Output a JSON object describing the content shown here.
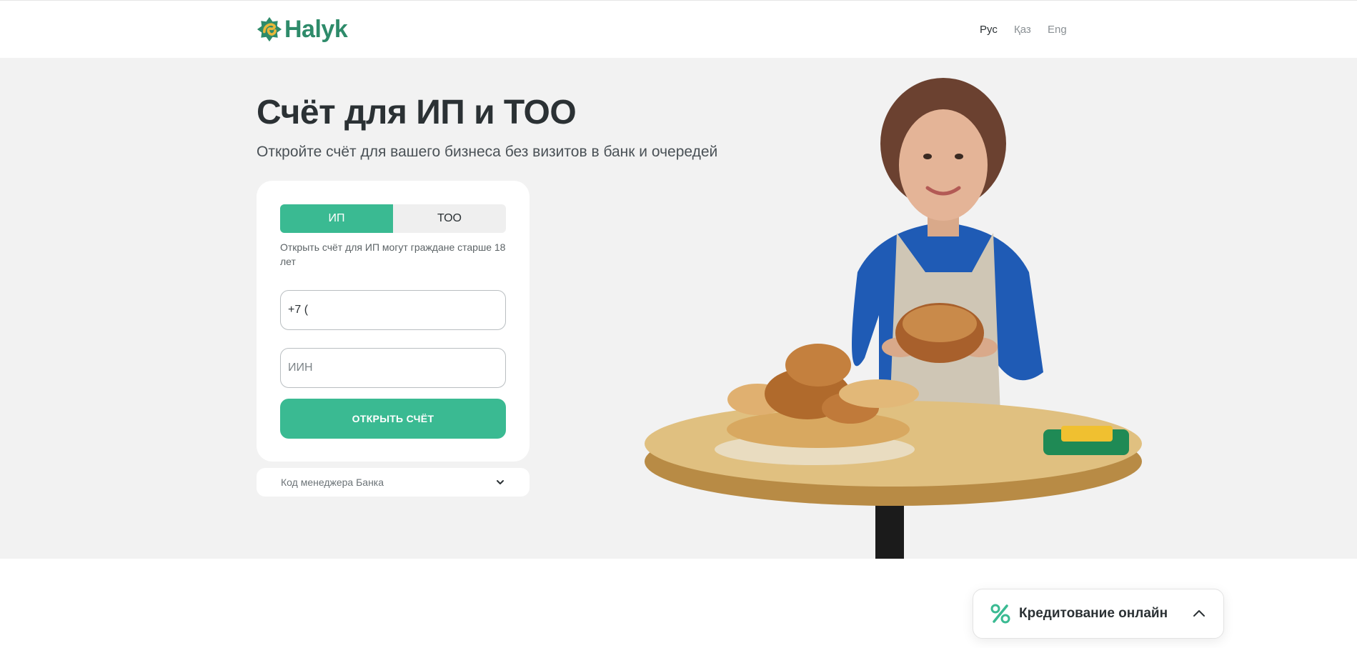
{
  "brand": {
    "name": "Halyk",
    "color": "#2e8b6a",
    "accent": "#3aba92"
  },
  "header": {
    "languages": [
      {
        "label": "Рус",
        "active": true
      },
      {
        "label": "Қаз",
        "active": false
      },
      {
        "label": "Eng",
        "active": false
      }
    ]
  },
  "hero": {
    "title": "Счёт для ИП и ТОО",
    "subtitle": "Откройте счёт для вашего бизнеса без визитов в банк и очередей"
  },
  "form": {
    "tabs": [
      {
        "label": "ИП",
        "active": true
      },
      {
        "label": "ТОО",
        "active": false
      }
    ],
    "hint": "Открыть счёт для ИП могут граждане старше 18 лет",
    "phone": {
      "value": "+7 (",
      "placeholder": ""
    },
    "iin": {
      "value": "",
      "placeholder": "ИИН"
    },
    "submit_label": "ОТКРЫТЬ СЧЁТ"
  },
  "manager": {
    "label": "Код менеджера Банка",
    "icon": "chevron-down-icon"
  },
  "widget": {
    "label": "Кредитование онлайн",
    "icon": "percent-icon",
    "chevron": "chevron-up-icon"
  }
}
